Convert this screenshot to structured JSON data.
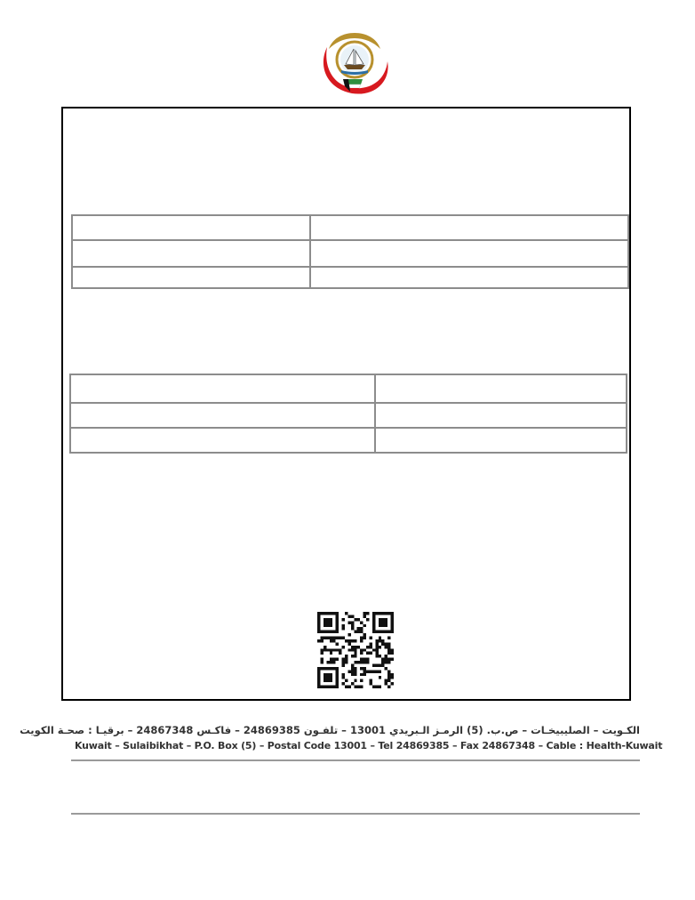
{
  "emblem": {
    "icon": "kuwait-emblem-icon",
    "colors": {
      "red": "#d7191f",
      "gold": "#b8912e",
      "blue": "#2a6ea5",
      "green": "#2f8f3e"
    }
  },
  "footer": {
    "address_ar": "الكـويت – الصليبيخـات – ص.ب. (5) الرمـز الـبريدي 13001 – تلفـون 24869385 – فاكـس 24867348 – برقيـا : صحـة الكويت",
    "address_en": "Kuwait – Sulaibikhat – P.O. Box (5) – Postal Code 13001 – Tel 24869385 – Fax 24867348 – Cable : Health-Kuwait"
  },
  "qr": {
    "icon": "qr-code-icon"
  }
}
